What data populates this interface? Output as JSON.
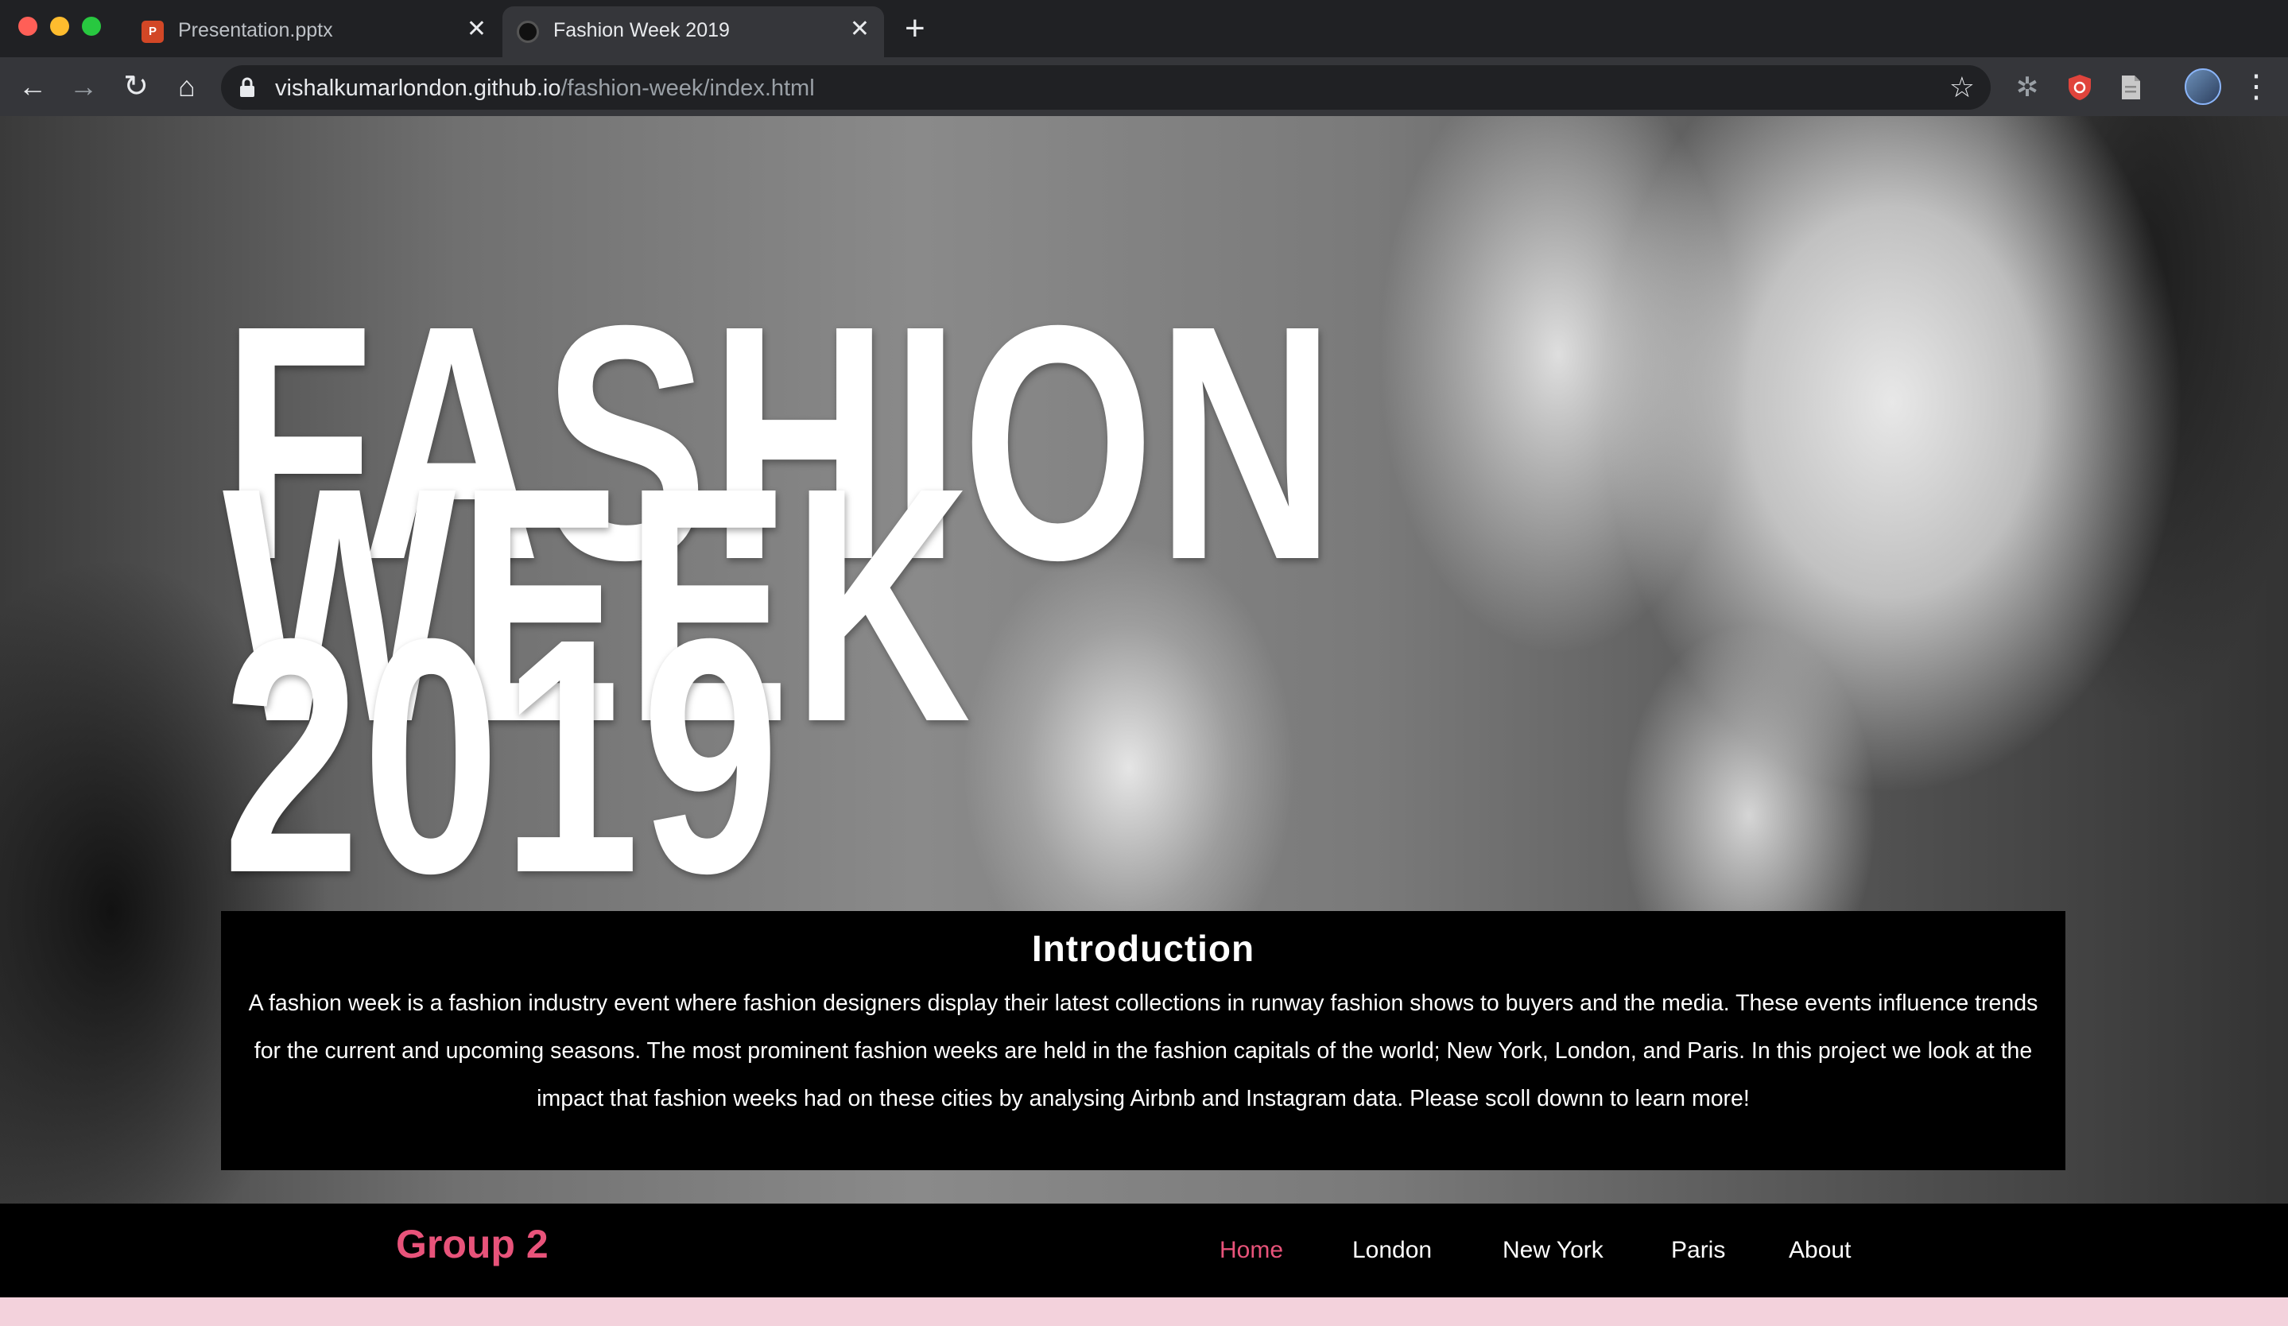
{
  "browser": {
    "tabs": [
      {
        "title": "Presentation.pptx",
        "favicon": "powerpoint-icon",
        "active": false
      },
      {
        "title": "Fashion Week 2019",
        "favicon": "site-icon",
        "active": true
      }
    ],
    "url_host": "vishalkumarlondon.github.io",
    "url_path": "/fashion-week/index.html"
  },
  "hero": {
    "title_line1": "FASHION",
    "title_line2": "WEEK",
    "title_line3": "2019",
    "background": "photo of models in white outfits backstage"
  },
  "intro": {
    "heading": "Introduction",
    "body": "A fashion week is a fashion industry event where fashion designers display their latest collections in runway fashion shows to buyers and the media. These events influence trends for the current and upcoming seasons. The most prominent fashion weeks are held in the fashion capitals of the world; New York, London, and Paris. In this project we look at the impact that fashion weeks had on these cities by analysing Airbnb and Instagram data. Please scoll downn to learn more!"
  },
  "nav": {
    "brand": "Group 2",
    "links": [
      "Home",
      "London",
      "New York",
      "Paris",
      "About"
    ],
    "active": "Home"
  },
  "colors": {
    "accent": "#e8537a",
    "nav_bg": "#000000",
    "chrome_bg": "#202124",
    "toolbar_bg": "#35363a",
    "band": "#f3d2dc"
  }
}
